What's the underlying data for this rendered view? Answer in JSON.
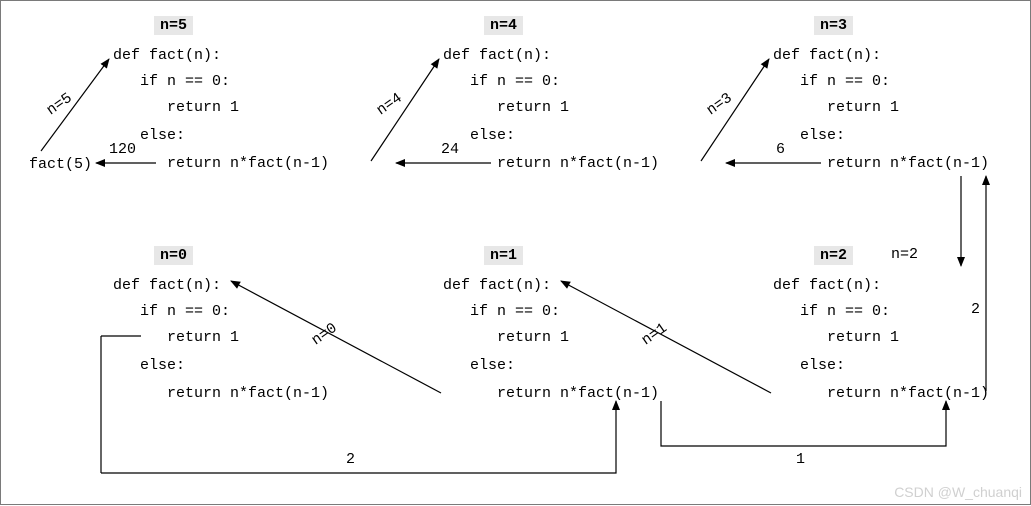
{
  "blocks": [
    {
      "id": "n5",
      "badge": "n=5"
    },
    {
      "id": "n4",
      "badge": "n=4"
    },
    {
      "id": "n3",
      "badge": "n=3"
    },
    {
      "id": "n0",
      "badge": "n=0"
    },
    {
      "id": "n1",
      "badge": "n=1"
    },
    {
      "id": "n2",
      "badge": "n=2"
    }
  ],
  "code": {
    "l1": "def fact(n):",
    "l2": "   if n == 0:",
    "l3": "      return 1",
    "l4": "   else:",
    "l5": "      return n*fact(n-1)"
  },
  "initial_call": "fact(5)",
  "call_labels": {
    "c5": "n=5",
    "c4": "n=4",
    "c3": "n=3",
    "c2": "n=2",
    "c1": "n=1",
    "c0": "n=0"
  },
  "return_labels": {
    "r120": "120",
    "r24": "24",
    "r6": "6",
    "r2a": "2",
    "r2b": "2",
    "r1": "1"
  },
  "watermark": "CSDN @W_chuanqi"
}
